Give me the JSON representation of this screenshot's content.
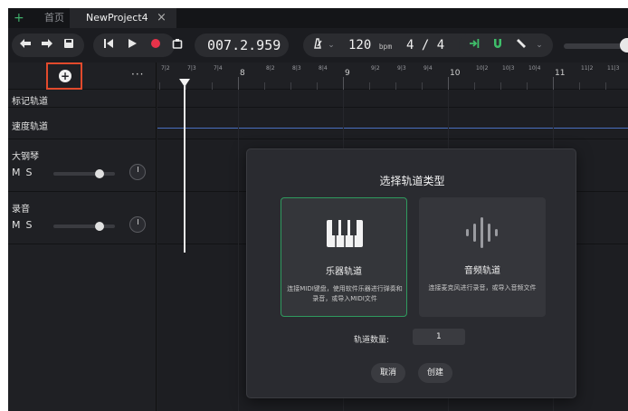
{
  "tabs": {
    "add_tab": "+",
    "home": "首页",
    "project": "NewProject4",
    "close": "×"
  },
  "toolbar": {
    "time": "007.2.959",
    "tempo": "120",
    "tempo_unit": "bpm",
    "time_signature": "4 / 4",
    "icons": [
      "undo-icon",
      "redo-icon",
      "save-icon",
      "skip-back-icon",
      "play-icon",
      "record-icon",
      "loop-icon",
      "metronome-icon",
      "chevron-down-icon",
      "snap-icon",
      "magnet-icon",
      "pencil-icon"
    ],
    "accent_color": "#3fbf6a",
    "record_color": "#e8334a"
  },
  "track_panel": {
    "more": "···",
    "marker_track": "标记轨道",
    "tempo_track": "速度轨道",
    "tracks": [
      {
        "name": "大钢琴",
        "mute": "M",
        "solo": "S",
        "volume": 0.7
      },
      {
        "name": "录音",
        "mute": "M",
        "solo": "S",
        "volume": 0.7
      }
    ]
  },
  "ruler": {
    "labels": [
      "7|2",
      "7|3",
      "7|4",
      "8",
      "8|2",
      "8|3",
      "8|4",
      "9",
      "9|2",
      "9|3",
      "9|4",
      "10",
      "10|2",
      "10|3",
      "10|4",
      "11",
      "11|2",
      "11|3"
    ]
  },
  "dialog": {
    "title": "选择轨道类型",
    "instrument": {
      "title": "乐器轨道",
      "desc": "连接MIDI键盘，使用软件乐器进行弹奏和录音，或导入MIDI文件"
    },
    "audio": {
      "title": "音频轨道",
      "desc": "连接麦克风进行录音，或导入音频文件"
    },
    "count_label": "轨道数量:",
    "count_value": "1",
    "cancel": "取消",
    "create": "创建"
  }
}
